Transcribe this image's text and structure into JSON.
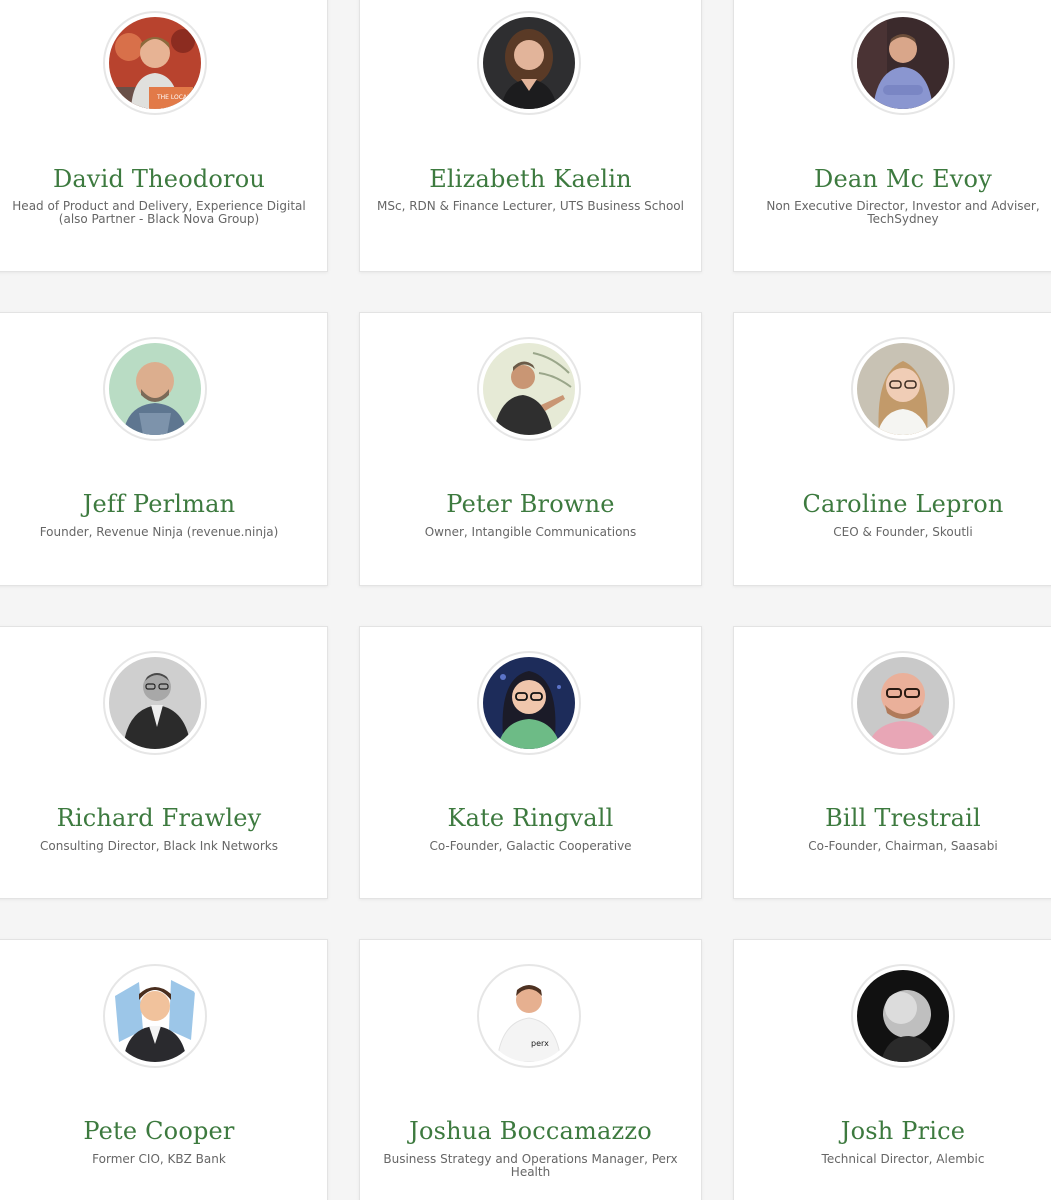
{
  "colors": {
    "name_green": "#3d7a3f",
    "role_gray": "#666666",
    "card_bg": "#ffffff",
    "page_bg": "#f5f5f5"
  },
  "people": [
    {
      "name": "David Theodorou",
      "role": "Head of Product and Delivery, Experience Digital (also Partner - Black Nova Group)",
      "avatar": "photo-man-speaking-icon"
    },
    {
      "name": "Elizabeth Kaelin",
      "role": "MSc, RDN & Finance Lecturer, UTS Business School",
      "avatar": "photo-woman-icon"
    },
    {
      "name": "Dean Mc Evoy",
      "role": "Non Executive Director, Investor and Adviser, TechSydney",
      "avatar": "photo-man-arms-crossed-icon"
    },
    {
      "name": "Jeff Perlman",
      "role": "Founder, Revenue Ninja (revenue.ninja)",
      "avatar": "photo-man-bald-icon"
    },
    {
      "name": "Peter Browne",
      "role": "Owner, Intangible Communications",
      "avatar": "photo-man-presenting-icon"
    },
    {
      "name": "Caroline Lepron",
      "role": "CEO & Founder, Skoutli",
      "avatar": "photo-woman-glasses-icon"
    },
    {
      "name": "Richard Frawley",
      "role": "Consulting Director, Black Ink Networks",
      "avatar": "photo-man-suit-bw-icon"
    },
    {
      "name": "Kate Ringvall",
      "role": "Co-Founder, Galactic Cooperative",
      "avatar": "photo-woman-glasses-icon"
    },
    {
      "name": "Bill Trestrail",
      "role": "Co-Founder, Chairman, Saasabi",
      "avatar": "photo-man-glasses-icon"
    },
    {
      "name": "Pete Cooper",
      "role": "Former CIO, KBZ Bank",
      "avatar": "cartoon-man-suit-icon"
    },
    {
      "name": "Joshua Boccamazzo",
      "role": "Business Strategy and Operations Manager, Perx Health",
      "avatar": "photo-man-white-shirt-icon"
    },
    {
      "name": "Josh Price",
      "role": "Technical Director, Alembic",
      "avatar": "photo-man-bw-icon"
    }
  ]
}
